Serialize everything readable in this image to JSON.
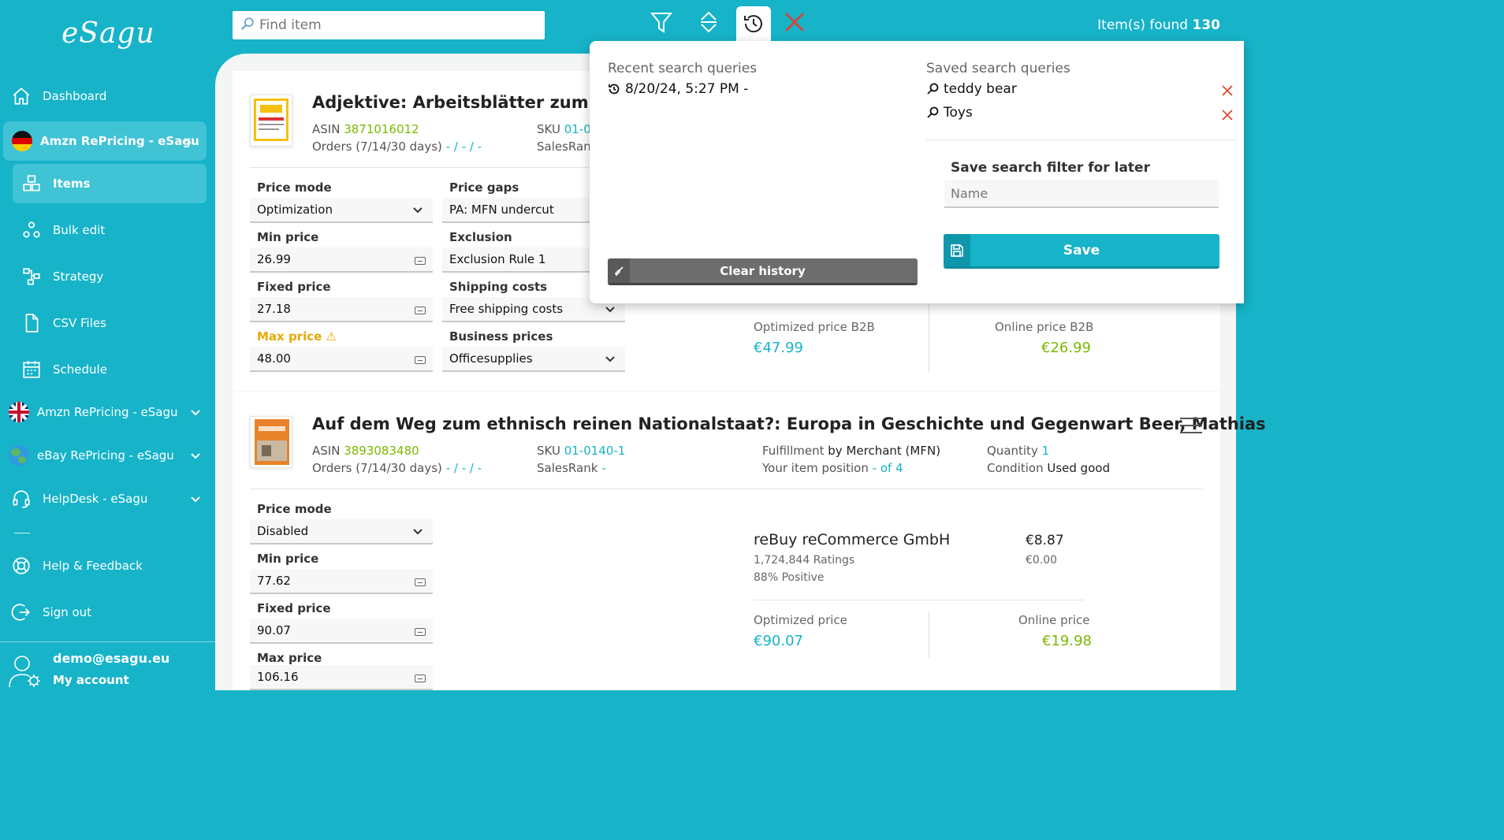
{
  "sidebar": {
    "logo": "eSagu",
    "items": [
      {
        "label": "Dashboard"
      },
      {
        "label": "Amzn RePricing - eSagu"
      },
      {
        "label": "Items"
      },
      {
        "label": "Bulk edit"
      },
      {
        "label": "Strategy"
      },
      {
        "label": "CSV Files"
      },
      {
        "label": "Schedule"
      },
      {
        "label": "Amzn RePricing - eSagu"
      },
      {
        "label": "eBay RePricing - eSagu"
      },
      {
        "label": "HelpDesk - eSagu"
      },
      {
        "label": "Help & Feedback"
      },
      {
        "label": "Sign out"
      }
    ],
    "account": {
      "email": "demo@esagu.eu",
      "label": "My account"
    }
  },
  "topbar": {
    "search_placeholder": "Find item",
    "found_label": "Item(s) found",
    "found_count": "130"
  },
  "products": [
    {
      "title": "Adjektive: Arbeitsblätter zum selbst",
      "asin_label": "ASIN",
      "asin": "3871016012",
      "sku_label": "SKU",
      "sku": "01-01",
      "orders_label": "Orders (7/14/30 days)",
      "orders": "- / - / -",
      "salesrank_label": "SalesRank",
      "fields": {
        "price_mode_label": "Price mode",
        "price_mode": "Optimization",
        "min_price_label": "Min price",
        "min_price": "26.99",
        "fixed_price_label": "Fixed price",
        "fixed_price": "27.18",
        "max_price_label": "Max price ⚠",
        "max_price": "48.00",
        "price_gaps_label": "Price gaps",
        "price_gaps": "PA: MFN undercut",
        "exclusion_label": "Exclusion",
        "exclusion": "Exclusion Rule 1",
        "shipping_label": "Shipping costs",
        "shipping": "Free shipping costs",
        "business_label": "Business prices",
        "business": "Officesupplies"
      },
      "optimized_label": "Optimized price B2B",
      "optimized": "€47.99",
      "online_label": "Online price B2B",
      "online": "€26.99"
    },
    {
      "title": "Auf dem Weg zum ethnisch reinen Nationalstaat?: Europa in Geschichte und Gegenwart Beer, Mathias",
      "asin_label": "ASIN",
      "asin": "3893083480",
      "sku_label": "SKU",
      "sku": "01-0140-1",
      "orders_label": "Orders (7/14/30 days)",
      "orders": "- / - / -",
      "salesrank_label": "SalesRank",
      "salesrank": "-",
      "fulfillment_label": "Fulfillment",
      "fulfillment": "by Merchant (MFN)",
      "position_label": "Your item position",
      "position_value": "- of",
      "position_total": "4",
      "quantity_label": "Quantity",
      "quantity": "1",
      "condition_label": "Condition",
      "condition": "Used good",
      "fields": {
        "price_mode_label": "Price mode",
        "price_mode": "Disabled",
        "min_price_label": "Min price",
        "min_price": "77.62",
        "fixed_price_label": "Fixed price",
        "fixed_price": "90.07",
        "max_price_label": "Max price",
        "max_price": "106.16"
      },
      "competitor": {
        "name": "reBuy reCommerce GmbH",
        "ratings": "1,724,844 Ratings",
        "positive": "88% Positive",
        "price": "€8.87",
        "shipping": "€0.00"
      },
      "optimized_label": "Optimized price",
      "optimized": "€90.07",
      "online_label": "Online price",
      "online": "€19.98"
    }
  ],
  "history_popup": {
    "recent_title": "Recent search queries",
    "recent": [
      "8/20/24, 5:27 PM -"
    ],
    "saved_title": "Saved search queries",
    "saved": [
      "teddy bear",
      "Toys"
    ],
    "save_title": "Save search filter for later",
    "name_placeholder": "Name",
    "save_label": "Save",
    "clear_label": "Clear history"
  },
  "colors": {
    "accent": "#16b3c9",
    "green": "#7ab800",
    "warn": "#e8a900",
    "close": "#e0402e"
  }
}
